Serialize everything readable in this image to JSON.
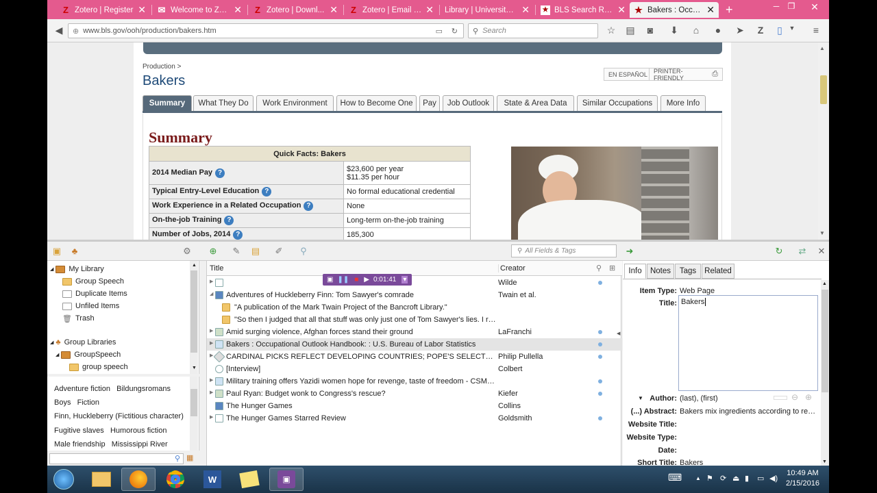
{
  "browser": {
    "tabs": [
      {
        "label": "Zotero | Register",
        "icon": "Z",
        "active": false
      },
      {
        "label": "Welcome to Zo...",
        "icon": "mail",
        "active": false
      },
      {
        "label": "Zotero | Downl...",
        "icon": "Z",
        "active": false
      },
      {
        "label": "Zotero | Email v...",
        "icon": "Z",
        "active": false
      },
      {
        "label": "Library | University ...",
        "icon": "",
        "active": false
      },
      {
        "label": "BLS Search Res...",
        "icon": "bls",
        "active": false
      },
      {
        "label": "Bakers : Occupa...",
        "icon": "star",
        "active": true
      }
    ],
    "url": "www.bls.gov/ooh/production/bakers.htm",
    "search_placeholder": "Search"
  },
  "page": {
    "breadcrumb": "Production >",
    "title": "Bakers",
    "espanol_btn": "EN ESPAÑOL",
    "printer_btn": "PRINTER-FRIENDLY",
    "tabs": [
      "Summary",
      "What They Do",
      "Work Environment",
      "How to Become One",
      "Pay",
      "Job Outlook",
      "State & Area Data",
      "Similar Occupations",
      "More Info"
    ],
    "summary_heading": "Summary",
    "quick_facts": {
      "header": "Quick Facts: Bakers",
      "rows": [
        {
          "label": "2014 Median Pay",
          "value": "$23,600 per year",
          "value2": "$11.35 per hour"
        },
        {
          "label": "Typical Entry-Level Education",
          "value": "No formal educational credential"
        },
        {
          "label": "Work Experience in a Related Occupation",
          "value": "None"
        },
        {
          "label": "On-the-job Training",
          "value": "Long-term on-the-job training"
        },
        {
          "label": "Number of Jobs, 2014",
          "value": "185,300"
        }
      ]
    }
  },
  "zotero": {
    "filter_placeholder": "All Fields & Tags",
    "collections": [
      {
        "label": "My Library"
      },
      {
        "label": "Group Speech"
      },
      {
        "label": "Duplicate Items"
      },
      {
        "label": "Unfiled Items"
      },
      {
        "label": "Trash"
      },
      {
        "label": "Group Libraries"
      },
      {
        "label": "GroupSpeech"
      },
      {
        "label": "group speech"
      }
    ],
    "tags": [
      [
        "Adventure fiction",
        "Bildungsromans"
      ],
      [
        "Boys",
        "Fiction"
      ],
      [
        "Finn, Huckleberry (Fictitious character)"
      ],
      [
        "Fugitive slaves",
        "Humorous fiction"
      ],
      [
        "Male friendship",
        "Mississippi River"
      ]
    ],
    "columns": {
      "title": "Title",
      "creator": "Creator"
    },
    "recorder_time": "0:01:41",
    "items": [
      {
        "title": "",
        "creator": "Wilde"
      },
      {
        "title": "Adventures of Huckleberry Finn: Tom Sawyer's comrade",
        "creator": "Twain et al."
      },
      {
        "title": "\"A publication of the Mark Twain Project of the Bancroft Library.\"",
        "creator": ""
      },
      {
        "title": "\"So then I judged that all that stuff was only just one of Tom Sawyer's lies. I reck...",
        "creator": ""
      },
      {
        "title": "Amid surging violence, Afghan forces stand their ground",
        "creator": "LaFranchi"
      },
      {
        "title": "Bakers : Occupational Outlook Handbook: : U.S. Bureau of Labor Statistics",
        "creator": ""
      },
      {
        "title": "CARDINAL PICKS REFLECT DEVELOPING COUNTRIES; POPE'S SELECTIONS SHIFT ...",
        "creator": "Philip Pullella"
      },
      {
        "title": "[Interview]",
        "creator": "Colbert"
      },
      {
        "title": "Military training offers Yazidi women hope for revenge, taste of freedom - CSMon...",
        "creator": ""
      },
      {
        "title": "Paul Ryan: Budget wonk to Congress's rescue?",
        "creator": "Kiefer"
      },
      {
        "title": "The Hunger Games",
        "creator": "Collins"
      },
      {
        "title": "The Hunger Games Starred Review",
        "creator": "Goldsmith"
      }
    ],
    "info_tabs": [
      "Info",
      "Notes",
      "Tags",
      "Related"
    ],
    "fields": {
      "item_type_label": "Item Type:",
      "item_type": "Web Page",
      "title_label": "Title:",
      "title": "Bakers",
      "author_label": "Author:",
      "author": "(last), (first)",
      "abstract_label": "(...) Abstract:",
      "abstract": "Bakers mix ingredients according to reci...",
      "website_title_label": "Website Title:",
      "website_type_label": "Website Type:",
      "date_label": "Date:",
      "short_title_label": "Short Title:",
      "short_title": "Bakers"
    }
  },
  "taskbar": {
    "time": "10:49 AM",
    "date": "2/15/2016"
  },
  "colors": {
    "tabstrip": "#e45a8e",
    "bls_tab": "#56697a",
    "summary_heading": "#7a1b1b"
  }
}
